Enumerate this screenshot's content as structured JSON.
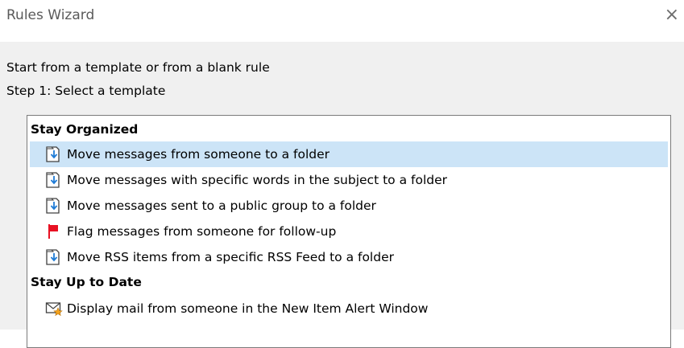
{
  "window": {
    "title": "Rules Wizard",
    "close_glyph": "×"
  },
  "header": {
    "line1": "Start from a template or from a blank rule",
    "line2": "Step 1: Select a template"
  },
  "groups": [
    {
      "label": "Stay Organized",
      "items": [
        {
          "label": "Move messages from someone to a folder",
          "icon": "move-to-folder-icon",
          "selected": true
        },
        {
          "label": "Move messages with specific words in the subject to a folder",
          "icon": "move-to-folder-icon",
          "selected": false
        },
        {
          "label": "Move messages sent to a public group to a folder",
          "icon": "move-to-folder-icon",
          "selected": false
        },
        {
          "label": "Flag messages from someone for follow-up",
          "icon": "flag-icon",
          "selected": false
        },
        {
          "label": "Move RSS items from a specific RSS Feed to a folder",
          "icon": "move-to-folder-icon",
          "selected": false
        }
      ]
    },
    {
      "label": "Stay Up to Date",
      "items": [
        {
          "label": "Display mail from someone in the New Item Alert Window",
          "icon": "alert-envelope-icon",
          "selected": false
        }
      ]
    }
  ],
  "colors": {
    "selection": "#cce4f7",
    "folder_arrow": "#1e7bd6",
    "flag": "#e81123",
    "star": "#f4a21b"
  }
}
